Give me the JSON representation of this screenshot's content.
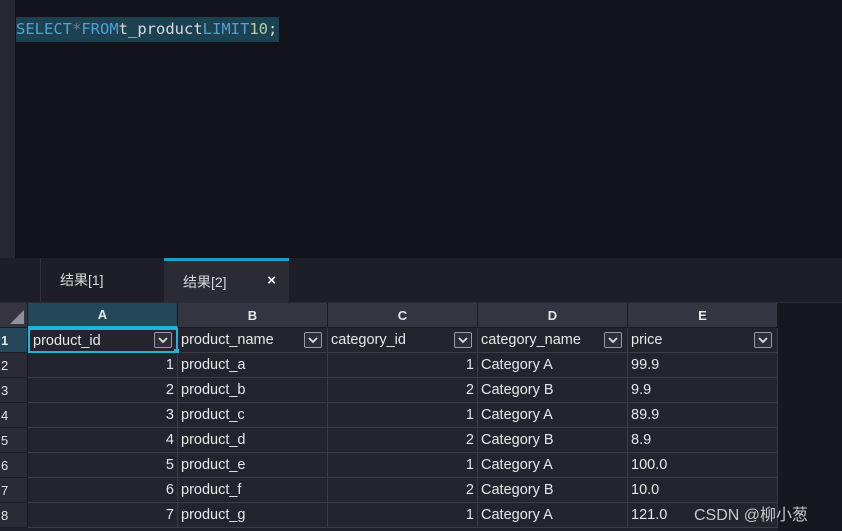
{
  "editor": {
    "sql": {
      "kw_select": "SELECT",
      "op_star": "*",
      "kw_from": "FROM",
      "table": "t_product",
      "kw_limit": "LIMIT",
      "limit_value": "10",
      "terminator": ";"
    }
  },
  "tabs": [
    {
      "label": "结果[1]"
    },
    {
      "label": "结果[2]",
      "close": "×"
    }
  ],
  "grid": {
    "columns": [
      "A",
      "B",
      "C",
      "D",
      "E"
    ],
    "row_numbers": [
      "1",
      "2",
      "3",
      "4",
      "5",
      "6",
      "7",
      "8"
    ],
    "headers": [
      "product_id",
      "product_name",
      "category_id",
      "category_name",
      "price"
    ],
    "rows": [
      [
        "1",
        "product_a",
        "1",
        "Category A",
        "99.9"
      ],
      [
        "2",
        "product_b",
        "2",
        "Category B",
        "9.9"
      ],
      [
        "3",
        "product_c",
        "1",
        "Category A",
        "89.9"
      ],
      [
        "4",
        "product_d",
        "2",
        "Category B",
        "8.9"
      ],
      [
        "5",
        "product_e",
        "1",
        "Category A",
        "100.0"
      ],
      [
        "6",
        "product_f",
        "2",
        "Category B",
        "10.0"
      ],
      [
        "7",
        "product_g",
        "1",
        "Category A",
        "121.0"
      ]
    ]
  },
  "watermark": "CSDN @柳小葱",
  "icons": {
    "filter": "chevron-down-icon",
    "close": "close-icon",
    "select_all": "select-all-triangle-icon"
  },
  "colors": {
    "accent": "#22b3d6",
    "keyword": "#4fa0d8",
    "number": "#b5cea8",
    "selection": "#1c4151"
  }
}
